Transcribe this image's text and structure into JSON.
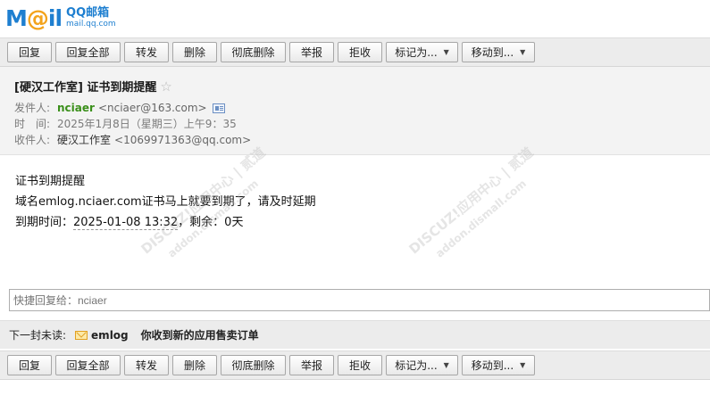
{
  "logo": {
    "brand": "MAIL",
    "product": "QQ邮箱",
    "domain": "mail.qq.com"
  },
  "toolbar": {
    "reply": "回复",
    "reply_all": "回复全部",
    "forward": "转发",
    "delete": "删除",
    "purge": "彻底删除",
    "report": "举报",
    "reject": "拒收",
    "mark_as": "标记为...",
    "move_to": "移动到..."
  },
  "mail": {
    "subject": "[硬汉工作室] 证书到期提醒",
    "sender_label": "发件人:",
    "sender_name": "nciaer",
    "sender_addr": "<nciaer@163.com>",
    "time_label": "时　间:",
    "time_value": "2025年1月8日（星期三）上午9：35",
    "recipient_label": "收件人:",
    "recipient_name": "硬汉工作室",
    "recipient_addr": "<1069971363@qq.com>"
  },
  "body": {
    "line1": "证书到期提醒",
    "line2": "域名emlog.nciaer.com证书马上就要到期了，请及时延期",
    "line3_prefix": "到期时间：",
    "line3_date": "2025-01-08 13:32",
    "line3_suffix": "，剩余：0天"
  },
  "watermarks": [
    "DISCUZ!应用中心 | 贰道",
    "addon.dismall.com"
  ],
  "quick_reply": {
    "placeholder": "快捷回复给：nciaer"
  },
  "next_mail": {
    "label": "下一封未读:",
    "from": "emlog",
    "subject": "你收到新的应用售卖订单"
  }
}
